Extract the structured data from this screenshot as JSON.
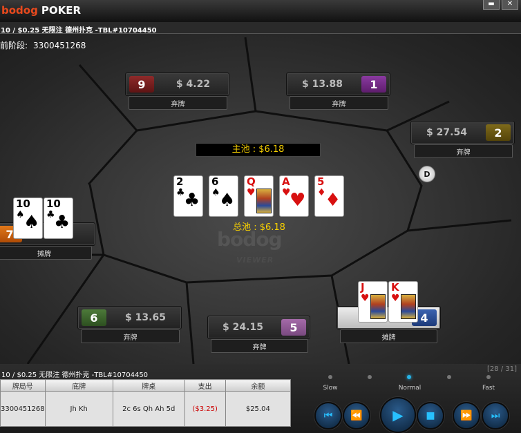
{
  "window": {
    "brand": "bodog",
    "product": "POKER",
    "min_icon": "▬",
    "close_icon": "✕"
  },
  "table_info": "10 / $0.25 无限注 德州扑克 -TBL#10704450",
  "hand": {
    "label": "前阶段:",
    "id": "3300451268"
  },
  "seats": [
    {
      "num": "9",
      "amount": "$ 4.22",
      "status": "弃牌",
      "color": "red"
    },
    {
      "num": "1",
      "amount": "$ 13.88",
      "status": "弃牌",
      "color": "purple"
    },
    {
      "num": "2",
      "amount": "$ 27.54",
      "status": "弃牌",
      "color": "olive"
    },
    {
      "num": "7",
      "amount": "",
      "status": "摊牌",
      "color": "orange"
    },
    {
      "num": "6",
      "amount": "$ 13.65",
      "status": "弃牌",
      "color": "green"
    },
    {
      "num": "5",
      "amount": "$ 24.15",
      "status": "弃牌",
      "color": "lav"
    },
    {
      "num": "4",
      "amount": "",
      "status": "摊牌",
      "color": "blue"
    }
  ],
  "main_pot": "主池 : $6.18",
  "total_pot": "总池 : $6.18",
  "dealer": "D",
  "watermark": {
    "logo": "bodog",
    "sub": "VIEWER"
  },
  "board": [
    {
      "rank": "2",
      "suit": "♣",
      "color": "black"
    },
    {
      "rank": "6",
      "suit": "♠",
      "color": "black"
    },
    {
      "rank": "Q",
      "suit": "♥",
      "color": "red",
      "face": true
    },
    {
      "rank": "A",
      "suit": "♥",
      "color": "red"
    },
    {
      "rank": "5",
      "suit": "♦",
      "color": "red"
    }
  ],
  "left_hand": [
    {
      "rank": "10",
      "suit": "♠",
      "color": "black"
    },
    {
      "rank": "10",
      "suit": "♣",
      "color": "black"
    }
  ],
  "right_hand": [
    {
      "rank": "J",
      "suit": "♥",
      "color": "red",
      "face": true
    },
    {
      "rank": "K",
      "suit": "♥",
      "color": "red",
      "face": true
    }
  ],
  "history": {
    "title": "10 / $0.25 无限注 德州扑克 -TBL#10704450",
    "count": "[28 / 31]",
    "headers": [
      "牌局号",
      "底牌",
      "牌桌",
      "支出",
      "余额"
    ],
    "row": [
      "3300451268",
      "Jh Kh",
      "2c 6s Qh Ah 5d",
      "($3.25)",
      "$25.04"
    ]
  },
  "speed": {
    "slow": "Slow",
    "normal": "Normal",
    "fast": "Fast",
    "level": "Normal"
  },
  "controls": [
    {
      "name": "first-button",
      "icon": "first-icon",
      "glyph": "⏮"
    },
    {
      "name": "rewind-button",
      "icon": "rewind-icon",
      "glyph": "⏪"
    },
    {
      "name": "play-button",
      "icon": "play-icon",
      "glyph": "▶"
    },
    {
      "name": "stop-button",
      "icon": "stop-icon",
      "glyph": "■"
    },
    {
      "name": "forward-button",
      "icon": "forward-icon",
      "glyph": "⏩"
    },
    {
      "name": "last-button",
      "icon": "last-icon",
      "glyph": "⏭"
    }
  ]
}
